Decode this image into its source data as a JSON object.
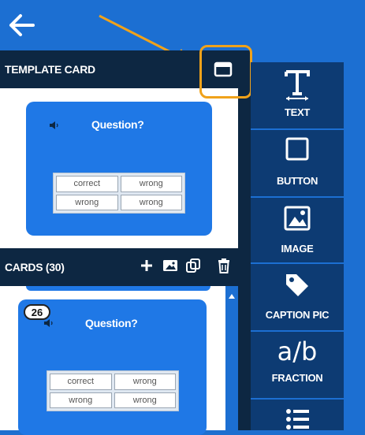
{
  "template_panel": {
    "title": "TEMPLATE CARD"
  },
  "template_card": {
    "question": "Question?",
    "answers": [
      "correct",
      "wrong",
      "wrong",
      "wrong"
    ]
  },
  "cards_panel": {
    "title": "CARDS (30)"
  },
  "card_preview": {
    "number": "26",
    "question": "Question?",
    "answers": [
      "correct",
      "wrong",
      "wrong",
      "wrong"
    ]
  },
  "tools": [
    {
      "label": "TEXT",
      "icon": "text-icon"
    },
    {
      "label": "BUTTON",
      "icon": "button-icon"
    },
    {
      "label": "IMAGE",
      "icon": "image-icon"
    },
    {
      "label": "CAPTION PIC",
      "icon": "tag-icon"
    },
    {
      "label": "FRACTION",
      "icon": "fraction-icon",
      "symbol": "a/b"
    },
    {
      "label": "",
      "icon": "list-icon"
    }
  ],
  "colors": {
    "accent": "#1c6fd2",
    "dark": "#0d2742",
    "tool": "#0d3b73",
    "highlight": "#f0a21a"
  }
}
